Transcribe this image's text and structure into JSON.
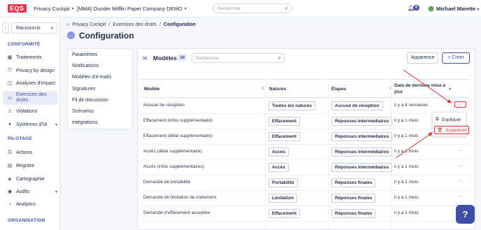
{
  "topbar": {
    "logo": "EQS",
    "product": "Privacy Cockpit",
    "company": "[MMA] Dunder Mifflin Paper Company DEMO",
    "search_placeholder": "Rechercher",
    "notifications": "0",
    "user": "Michael Marette"
  },
  "sidebar": {
    "shortcut": "Raccourcis",
    "sections": [
      {
        "title": "CONFORMITÉ"
      },
      {
        "title": "PILOTAGE"
      },
      {
        "title": "ORGANISATION"
      }
    ],
    "items": [
      {
        "label": "Traitements",
        "icon": "grid-icon"
      },
      {
        "label": "Privacy by design",
        "icon": "shield-icon"
      },
      {
        "label": "Analyses d'impact",
        "icon": "chart-icon"
      },
      {
        "label": "Exercices des droits",
        "icon": "chat-icon"
      },
      {
        "label": "Violations",
        "icon": "alert-icon"
      },
      {
        "label": "Systèmes d'IA",
        "icon": "ai-icon"
      },
      {
        "label": "Actions",
        "icon": "list-icon"
      },
      {
        "label": "Registre",
        "icon": "book-icon"
      },
      {
        "label": "Cartographie",
        "icon": "map-icon"
      },
      {
        "label": "Audits",
        "icon": "audit-icon"
      },
      {
        "label": "Analytics",
        "icon": "analytics-icon"
      }
    ]
  },
  "breadcrumb": {
    "items": [
      "Privacy Cockpit",
      "Exercices des droits",
      "Configuration"
    ]
  },
  "page_title": "Configuration",
  "settings_nav": [
    "Paramètres",
    "Notifications",
    "Modèles d'e-mails",
    "Signatures",
    "Fil de discussion",
    "Scénarios",
    "Intégrations"
  ],
  "models": {
    "title": "Modèles",
    "count": "36",
    "search_placeholder": "Rechercher",
    "btn_appearance": "Apparence",
    "btn_create": "Créer",
    "columns": {
      "model": "Modèle",
      "natures": "Natures",
      "steps": "Étapes",
      "date": "Date de dernière mise à jour"
    },
    "rows": [
      {
        "model": "Accusé de réception",
        "nature": "Toutes les natures",
        "step": "Accusé de réception",
        "date": "il y a 4 semaines"
      },
      {
        "model": "Effacement (infos supplémentaire)",
        "nature": "Effacement",
        "step": "Réponses intermédiaires",
        "date": "il y a 1 mois"
      },
      {
        "model": "Effacement (délai supplémentaire)",
        "nature": "Effacement",
        "step": "Réponses intermédiaires",
        "date": "il y a 1 mois"
      },
      {
        "model": "Accès (délai supplémentaire)",
        "nature": "Accès",
        "step": "Réponses intermédiaires",
        "date": "il y a 1 mois"
      },
      {
        "model": "Accès (infos supplémentaires)",
        "nature": "Accès",
        "step": "Réponses intermédiaires",
        "date": "il y a 1 mois"
      },
      {
        "model": "Demande de portabilité",
        "nature": "Portabilité",
        "step": "Réponses finales",
        "date": "il y a 1 mois"
      },
      {
        "model": "Demande de limitation de traitement",
        "nature": "Limitation",
        "step": "Réponses finales",
        "date": "il y a 1 mois"
      },
      {
        "model": "Demande d'effacement acceptée",
        "nature": "Effacement",
        "step": "Réponses finales",
        "date": "il y a 1 mois"
      }
    ],
    "menu": {
      "duplicate": "Dupliquer",
      "delete": "Supprimer"
    }
  }
}
